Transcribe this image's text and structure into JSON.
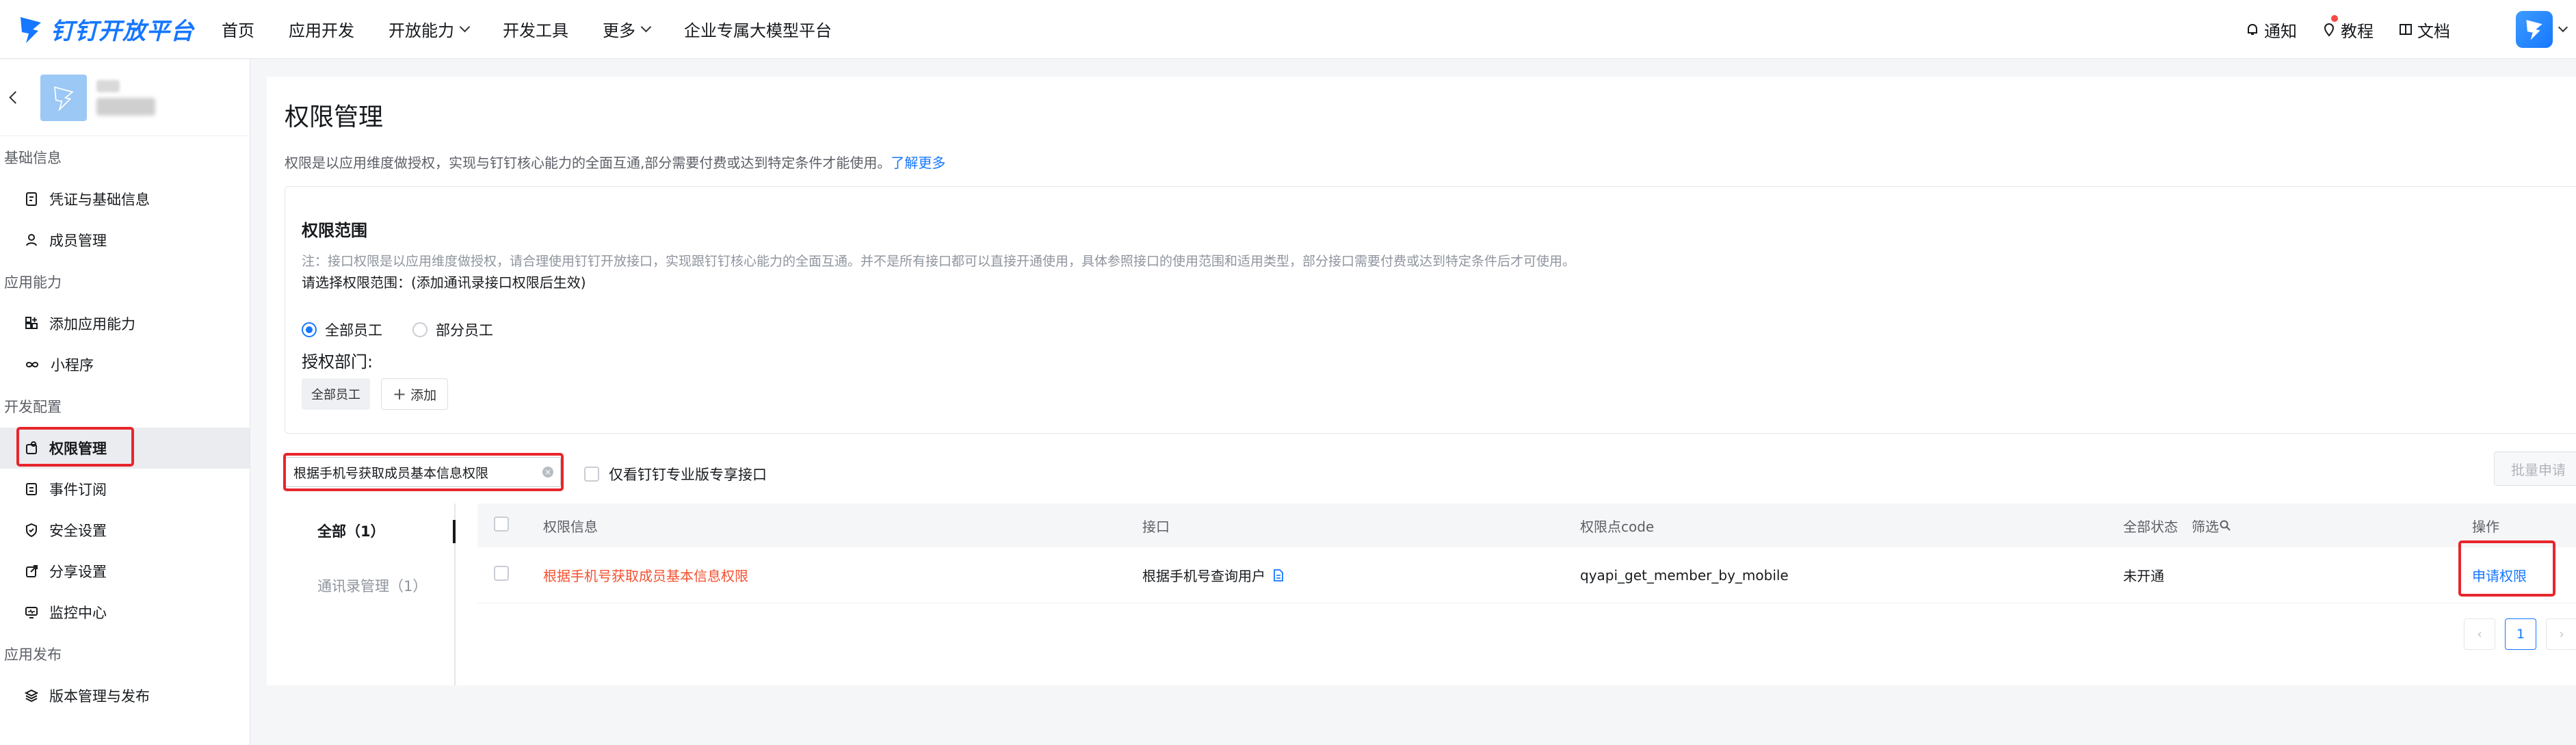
{
  "brand": {
    "name": "钉钉开放平台"
  },
  "topnav": {
    "items": [
      {
        "label": "首页",
        "dropdown": false
      },
      {
        "label": "应用开发",
        "dropdown": false
      },
      {
        "label": "开放能力",
        "dropdown": true
      },
      {
        "label": "开发工具",
        "dropdown": false
      },
      {
        "label": "更多",
        "dropdown": true
      },
      {
        "label": "企业专属大模型平台",
        "dropdown": false
      }
    ],
    "right": {
      "notify": "通知",
      "tutorial": "教程",
      "docs": "文档"
    }
  },
  "sidebar": {
    "groups": [
      {
        "title": "基础信息",
        "items": [
          {
            "label": "凭证与基础信息",
            "icon": "credential-icon"
          },
          {
            "label": "成员管理",
            "icon": "member-icon"
          }
        ]
      },
      {
        "title": "应用能力",
        "items": [
          {
            "label": "添加应用能力",
            "icon": "add-capability-icon"
          },
          {
            "label": "小程序",
            "icon": "miniapp-icon"
          }
        ]
      },
      {
        "title": "开发配置",
        "items": [
          {
            "label": "权限管理",
            "icon": "permission-icon",
            "active": true
          },
          {
            "label": "事件订阅",
            "icon": "event-icon"
          },
          {
            "label": "安全设置",
            "icon": "shield-icon"
          },
          {
            "label": "分享设置",
            "icon": "share-icon"
          },
          {
            "label": "监控中心",
            "icon": "monitor-icon"
          }
        ]
      },
      {
        "title": "应用发布",
        "items": [
          {
            "label": "版本管理与发布",
            "icon": "layers-icon"
          }
        ]
      }
    ]
  },
  "page": {
    "title": "权限管理",
    "desc": "权限是以应用维度做授权，实现与钉钉核心能力的全面互通,部分需要付费或达到特定条件才能使用。",
    "learn_more": "了解更多"
  },
  "scope": {
    "title": "权限范围",
    "note": "注：接口权限是以应用维度做授权，请合理使用钉钉开放接口，实现跟钉钉核心能力的全面互通。并不是所有接口都可以直接开通使用，具体参照接口的使用范围和适用类型，部分接口需要付费或达到特定条件后才可使用。",
    "select_label": "请选择权限范围：(添加通讯录接口权限后生效)",
    "radio_all": "全部员工",
    "radio_part": "部分员工",
    "selected": "全部员工",
    "dept_label": "授权部门:",
    "dept_tag": "全部员工",
    "add_label": "添加"
  },
  "filter": {
    "search_value": "根据手机号获取成员基本信息权限",
    "only_pro_label": "仅看钉钉专业版专享接口",
    "batch_label": "批量申请"
  },
  "categories": [
    {
      "label": "全部（1）",
      "active": true
    },
    {
      "label": "通讯录管理（1）",
      "active": false
    }
  ],
  "table": {
    "headers": {
      "info": "权限信息",
      "api": "接口",
      "code": "权限点code",
      "status": "全部状态",
      "filter": "筛选",
      "op": "操作"
    },
    "rows": [
      {
        "info": "根据手机号获取成员基本信息权限",
        "api": "根据手机号查询用户",
        "code": "qyapi_get_member_by_mobile",
        "status": "未开通",
        "op": "申请权限"
      }
    ]
  },
  "pagination": {
    "current": "1"
  },
  "colors": {
    "accent": "#1677ff",
    "highlight": "#e8262d",
    "perm_link": "#f5502f"
  }
}
